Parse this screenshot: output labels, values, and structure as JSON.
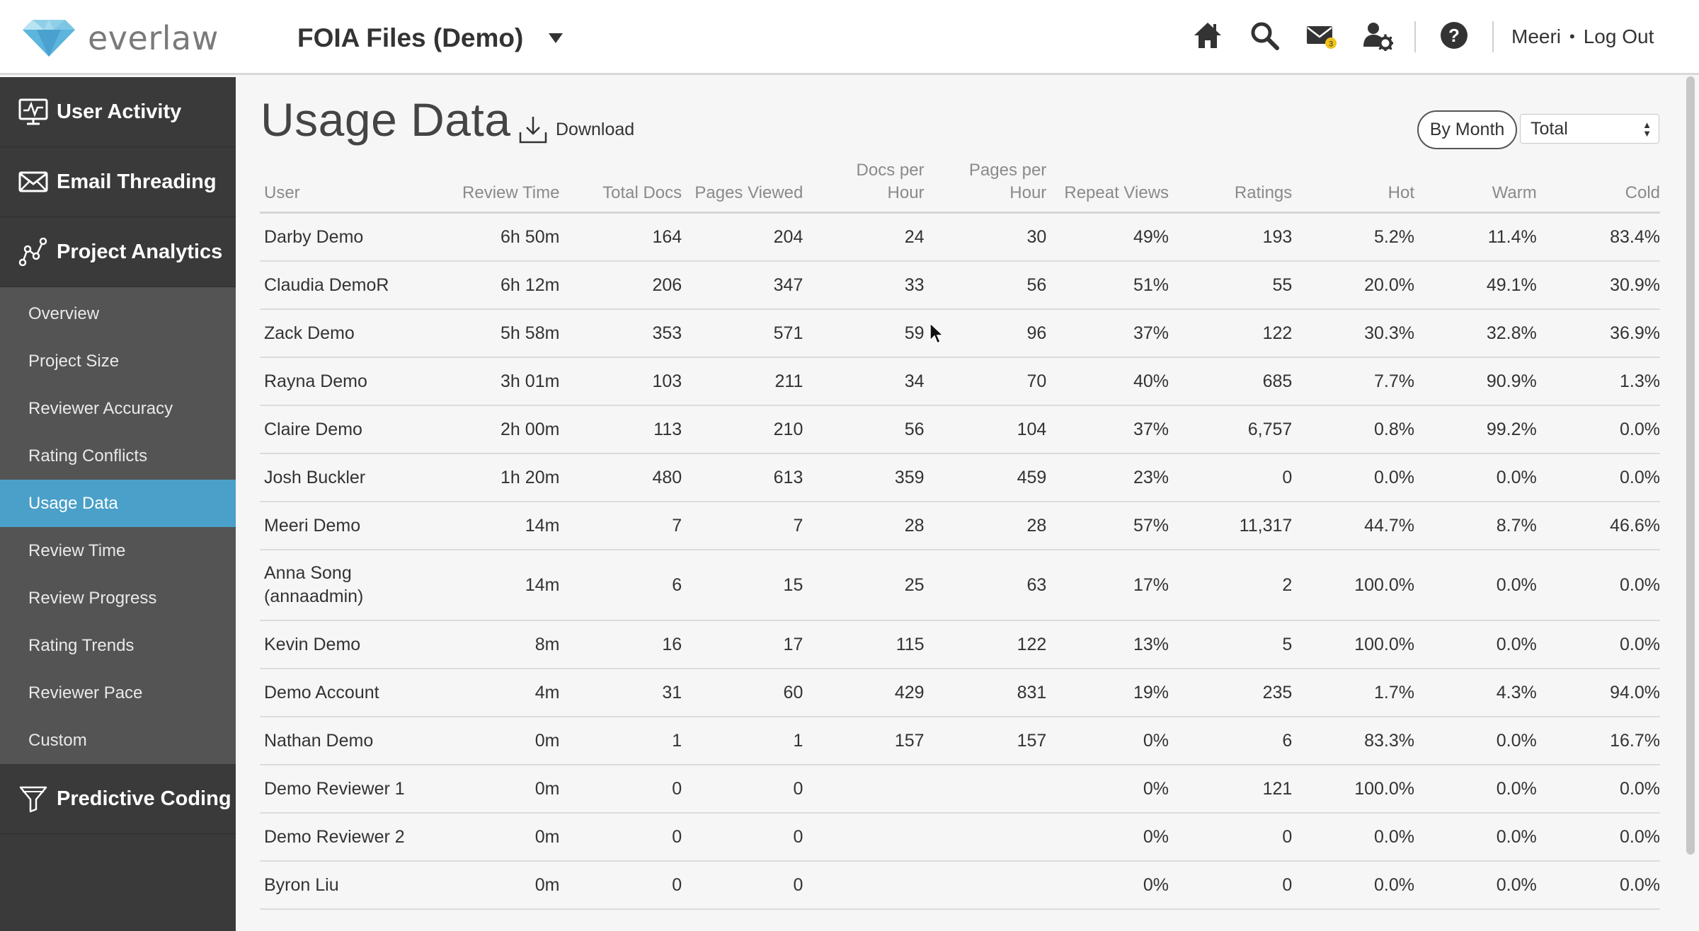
{
  "header": {
    "logo_text": "everlaw",
    "project_name": "FOIA Files (Demo)",
    "icons": [
      "home-icon",
      "search-icon",
      "mail-icon",
      "user-settings-icon",
      "help-icon"
    ],
    "mail_badge": "3",
    "user_name": "Meeri",
    "separator": "•",
    "logout_label": "Log Out"
  },
  "sidebar": {
    "main_items": [
      {
        "label": "User Activity",
        "icon": "activity-monitor-icon"
      },
      {
        "label": "Email Threading",
        "icon": "envelope-icon"
      },
      {
        "label": "Project Analytics",
        "icon": "analytics-graph-icon"
      }
    ],
    "sub_items": [
      {
        "label": "Overview",
        "active": false
      },
      {
        "label": "Project Size",
        "active": false
      },
      {
        "label": "Reviewer Accuracy",
        "active": false
      },
      {
        "label": "Rating Conflicts",
        "active": false
      },
      {
        "label": "Usage Data",
        "active": true
      },
      {
        "label": "Review Time",
        "active": false
      },
      {
        "label": "Review Progress",
        "active": false
      },
      {
        "label": "Rating Trends",
        "active": false
      },
      {
        "label": "Reviewer Pace",
        "active": false
      },
      {
        "label": "Custom",
        "active": false
      }
    ],
    "bottom_item": {
      "label": "Predictive Coding",
      "icon": "funnel-icon"
    }
  },
  "main": {
    "title": "Usage Data",
    "download_label": "Download",
    "by_month_label": "By Month",
    "period_selected": "Total"
  },
  "table": {
    "columns": [
      {
        "line1": "",
        "line2": "User"
      },
      {
        "line1": "",
        "line2": "Review Time"
      },
      {
        "line1": "",
        "line2": "Total Docs"
      },
      {
        "line1": "",
        "line2": "Pages Viewed"
      },
      {
        "line1": "Docs per",
        "line2": "Hour"
      },
      {
        "line1": "Pages per",
        "line2": "Hour"
      },
      {
        "line1": "",
        "line2": "Repeat Views"
      },
      {
        "line1": "",
        "line2": "Ratings"
      },
      {
        "line1": "",
        "line2": "Hot"
      },
      {
        "line1": "",
        "line2": "Warm"
      },
      {
        "line1": "",
        "line2": "Cold"
      }
    ],
    "rows": [
      [
        "Darby Demo",
        "6h 50m",
        "164",
        "204",
        "24",
        "30",
        "49%",
        "193",
        "5.2%",
        "11.4%",
        "83.4%"
      ],
      [
        "Claudia DemoR",
        "6h 12m",
        "206",
        "347",
        "33",
        "56",
        "51%",
        "55",
        "20.0%",
        "49.1%",
        "30.9%"
      ],
      [
        "Zack Demo",
        "5h 58m",
        "353",
        "571",
        "59",
        "96",
        "37%",
        "122",
        "30.3%",
        "32.8%",
        "36.9%"
      ],
      [
        "Rayna Demo",
        "3h 01m",
        "103",
        "211",
        "34",
        "70",
        "40%",
        "685",
        "7.7%",
        "90.9%",
        "1.3%"
      ],
      [
        "Claire Demo",
        "2h 00m",
        "113",
        "210",
        "56",
        "104",
        "37%",
        "6,757",
        "0.8%",
        "99.2%",
        "0.0%"
      ],
      [
        "Josh Buckler",
        "1h 20m",
        "480",
        "613",
        "359",
        "459",
        "23%",
        "0",
        "0.0%",
        "0.0%",
        "0.0%"
      ],
      [
        "Meeri Demo",
        "14m",
        "7",
        "7",
        "28",
        "28",
        "57%",
        "11,317",
        "44.7%",
        "8.7%",
        "46.6%"
      ],
      [
        "Anna Song (annaadmin)",
        "14m",
        "6",
        "15",
        "25",
        "63",
        "17%",
        "2",
        "100.0%",
        "0.0%",
        "0.0%"
      ],
      [
        "Kevin Demo",
        "8m",
        "16",
        "17",
        "115",
        "122",
        "13%",
        "5",
        "100.0%",
        "0.0%",
        "0.0%"
      ],
      [
        "Demo Account",
        "4m",
        "31",
        "60",
        "429",
        "831",
        "19%",
        "235",
        "1.7%",
        "4.3%",
        "94.0%"
      ],
      [
        "Nathan Demo",
        "0m",
        "1",
        "1",
        "157",
        "157",
        "0%",
        "6",
        "83.3%",
        "0.0%",
        "16.7%"
      ],
      [
        "Demo Reviewer 1",
        "0m",
        "0",
        "0",
        "",
        "",
        "0%",
        "121",
        "100.0%",
        "0.0%",
        "0.0%"
      ],
      [
        "Demo Reviewer 2",
        "0m",
        "0",
        "0",
        "",
        "",
        "0%",
        "0",
        "0.0%",
        "0.0%",
        "0.0%"
      ],
      [
        "Byron Liu",
        "0m",
        "0",
        "0",
        "",
        "",
        "0%",
        "0",
        "0.0%",
        "0.0%",
        "0.0%"
      ]
    ]
  }
}
